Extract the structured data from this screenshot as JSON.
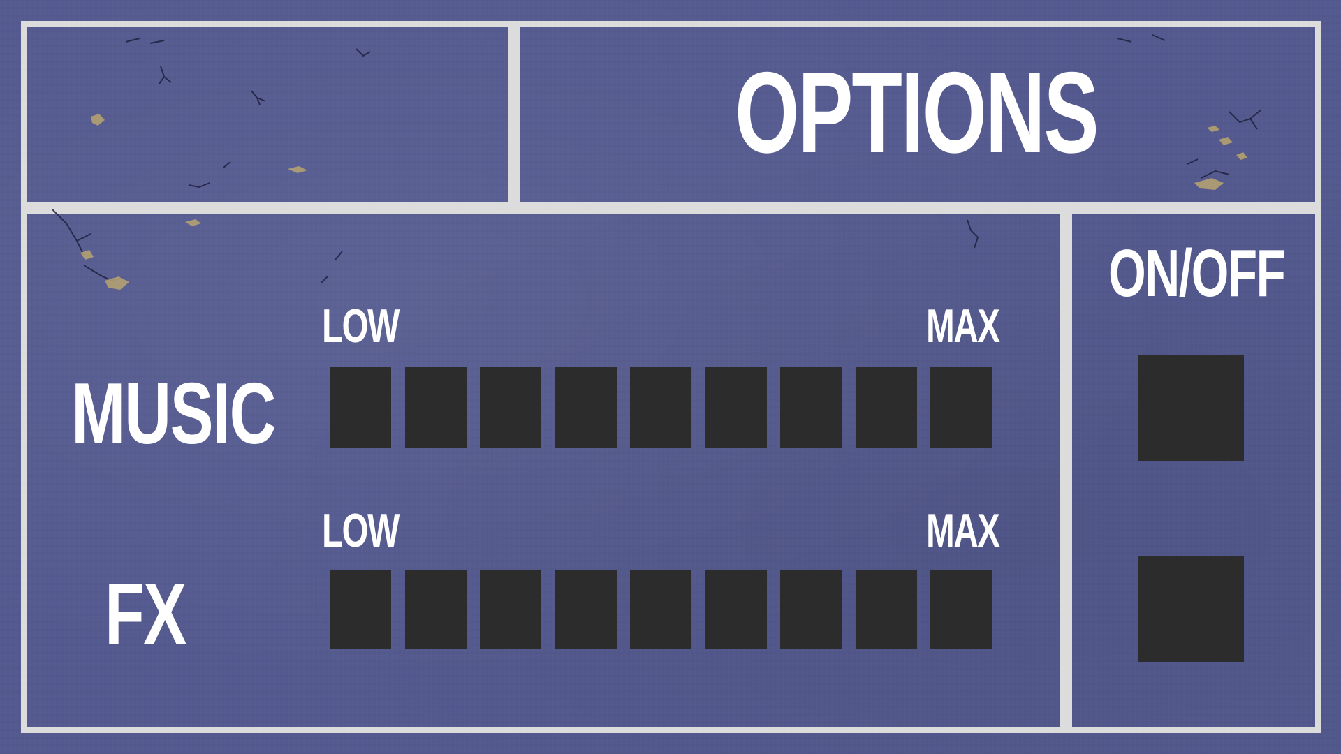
{
  "header": {
    "title": "OPTIONS"
  },
  "sidebar": {
    "heading": "ON/OFF"
  },
  "music": {
    "label": "MUSIC",
    "low_label": "LOW",
    "max_label": "MAX",
    "level_steps": 9,
    "level": 0,
    "enabled": false
  },
  "fx": {
    "label": "FX",
    "low_label": "LOW",
    "max_label": "MAX",
    "level_steps": 9,
    "level": 0,
    "enabled": false
  },
  "colors": {
    "background": "#545a8f",
    "frame": "#dcdcdc",
    "slot_empty": "#2c2c2c",
    "slot_filled": "#f2f2f2",
    "text": "#ffffff"
  }
}
